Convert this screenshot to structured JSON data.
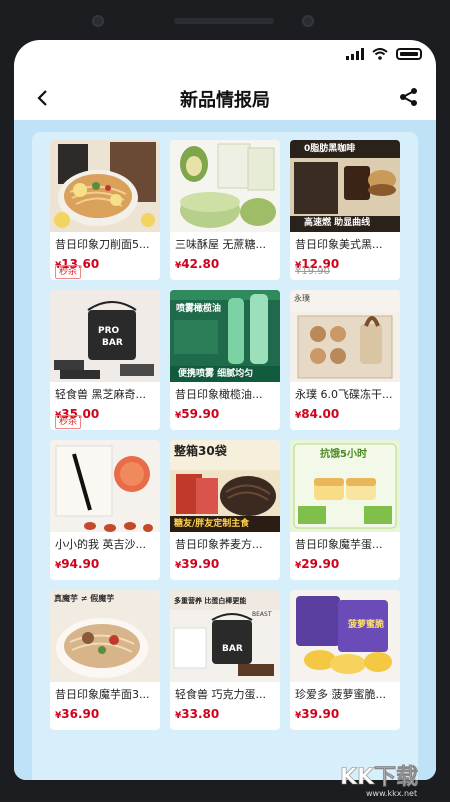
{
  "header": {
    "title": "新品情报局"
  },
  "status": {
    "icons": [
      "signal-icon",
      "wifi-icon",
      "battery-icon"
    ]
  },
  "products": [
    {
      "name": "昔日印象刀削面5...",
      "price": "13.60",
      "tag": "秒杀",
      "thumb": "noodle-bowl"
    },
    {
      "name": "三味酥屋 无蔗糖...",
      "price": "42.80",
      "thumb": "green-pastry"
    },
    {
      "name": "昔日印象美式黑...",
      "price": "12.90",
      "original": "19.90",
      "thumb": "black-coffee",
      "overlay": [
        "0脂肪黑咖啡",
        "高速燃 助显曲线"
      ]
    },
    {
      "name": "轻食兽 黑芝麻奇...",
      "price": "35.00",
      "tag": "秒杀",
      "thumb": "protein-bar-bucket",
      "overlay": [
        "PRO",
        "BAR"
      ]
    },
    {
      "name": "昔日印象橄榄油...",
      "price": "59.90",
      "thumb": "olive-oil-spray",
      "overlay": [
        "喷雾橄榄油",
        "便携喷雾 细腻均匀"
      ]
    },
    {
      "name": "永璞 6.0飞碟冻干...",
      "price": "84.00",
      "thumb": "freeze-dried-coffee",
      "overlay": [
        "永璞"
      ]
    },
    {
      "name": "小小的我 英吉沙...",
      "price": "94.90",
      "thumb": "apricot-box"
    },
    {
      "name": "昔日印象荞麦方...",
      "price": "39.90",
      "thumb": "buckwheat-noodles",
      "overlay": [
        "整箱30袋",
        "糖友/胖友定制主食"
      ]
    },
    {
      "name": "昔日印象魔芋蛋...",
      "price": "29.90",
      "thumb": "konjac-cake",
      "overlay": [
        "抗饿5小时"
      ]
    },
    {
      "name": "昔日印象魔芋面3...",
      "price": "36.90",
      "thumb": "konjac-noodles",
      "overlay": [
        "真魔芋 ≠ 假魔芋"
      ]
    },
    {
      "name": "轻食兽 巧克力蛋...",
      "price": "33.80",
      "thumb": "chocolate-protein",
      "overlay": [
        "多重营养 比蛋白棒更能",
        "BEAST",
        "BAR"
      ]
    },
    {
      "name": "珍爱多 菠萝蜜脆...",
      "price": "39.90",
      "thumb": "jackfruit-chips",
      "overlay": [
        "菠萝蜜脆"
      ]
    }
  ],
  "currency": "¥",
  "watermark": "KK下载",
  "watermark_url": "www.kkx.net",
  "colors": {
    "price": "#d0021b",
    "page_bg": "#bfe2f6",
    "panel_bg": "#d7eefb"
  }
}
